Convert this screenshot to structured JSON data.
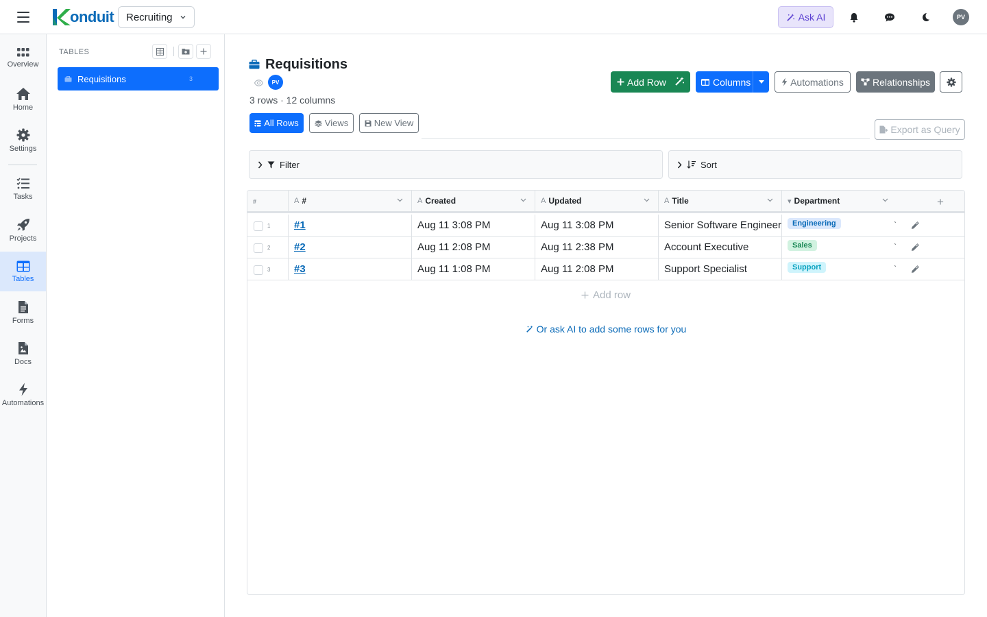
{
  "header": {
    "logo_text": "onduit",
    "workspace": "Recruiting",
    "ask_ai_label": "Ask AI",
    "avatar_initials": "PV"
  },
  "rail": {
    "items": [
      {
        "label": "Overview",
        "icon": "grid-dots-icon"
      },
      {
        "label": "Home",
        "icon": "home-icon"
      },
      {
        "label": "Settings",
        "icon": "gear-icon"
      },
      {
        "label": "Tasks",
        "icon": "checklist-icon"
      },
      {
        "label": "Projects",
        "icon": "rocket-icon"
      },
      {
        "label": "Tables",
        "icon": "table-icon",
        "active": true
      },
      {
        "label": "Forms",
        "icon": "document-icon"
      },
      {
        "label": "Docs",
        "icon": "image-doc-icon"
      },
      {
        "label": "Automations",
        "icon": "bolt-icon"
      }
    ]
  },
  "tables_panel": {
    "heading": "TABLES",
    "items": [
      {
        "label": "Requisitions",
        "count": "3"
      }
    ]
  },
  "main": {
    "title": "Requisitions",
    "owner_initials": "PV",
    "meta": "3 rows · 12 columns",
    "buttons": {
      "add_row": "Add Row",
      "columns": "Columns",
      "automations": "Automations",
      "relationships": "Relationships",
      "export": "Export as Query"
    },
    "view_tabs": {
      "all_rows": "All Rows",
      "views": "Views",
      "new_view": "New View"
    },
    "filter_label": "Filter",
    "sort_label": "Sort"
  },
  "grid": {
    "row_number_header": "#",
    "columns": [
      {
        "label": "#",
        "type": "A"
      },
      {
        "label": "Created",
        "type": "A"
      },
      {
        "label": "Updated",
        "type": "A"
      },
      {
        "label": "Title",
        "type": "A"
      },
      {
        "label": "Department",
        "type": "▾"
      }
    ],
    "rows": [
      {
        "n": "1",
        "id": "#1",
        "created": "Aug 11 3:08 PM",
        "updated": "Aug 11 3:08 PM",
        "title": "Senior Software Engineer",
        "department": "Engineering"
      },
      {
        "n": "2",
        "id": "#2",
        "created": "Aug 11 2:08 PM",
        "updated": "Aug 11 2:38 PM",
        "title": "Account Executive",
        "department": "Sales"
      },
      {
        "n": "3",
        "id": "#3",
        "created": "Aug 11 1:08 PM",
        "updated": "Aug 11 2:08 PM",
        "title": "Support Specialist",
        "department": "Support"
      }
    ],
    "add_row_label": "Add row",
    "ask_ai_rows_label": "Or ask AI to add some rows for you"
  },
  "colors": {
    "primary": "#0d6efd",
    "success": "#198754",
    "secondary": "#6c757d",
    "engineering_badge_bg": "#dbe8fc",
    "engineering_badge_fg": "#0b6bb8",
    "sales_badge_bg": "#d1f2e0",
    "sales_badge_fg": "#198754",
    "support_badge_bg": "#cff4fc",
    "support_badge_fg": "#0aa2c0"
  }
}
